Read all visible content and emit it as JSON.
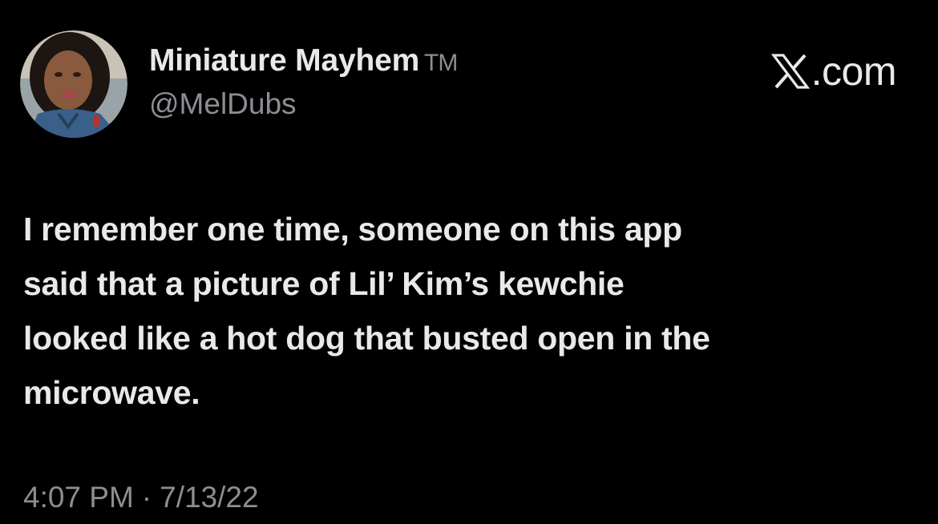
{
  "author": {
    "display_name": "Miniature Mayhem",
    "tm_mark": "TM",
    "handle": "@MelDubs"
  },
  "brand": {
    "label": ".com",
    "icon": "x-logo-icon"
  },
  "tweet": {
    "lines": [
      "I remember one time, someone on this app",
      "said that a picture of Lil’ Kim’s kewchie",
      "looked like a hot dog that busted open in the",
      "microwave."
    ]
  },
  "meta": {
    "time": "4:07 PM",
    "separator": "·",
    "date": "7/13/22"
  },
  "colors": {
    "background": "#000000",
    "primary_text": "#e7e9ea",
    "secondary_text": "#8b8f93"
  }
}
